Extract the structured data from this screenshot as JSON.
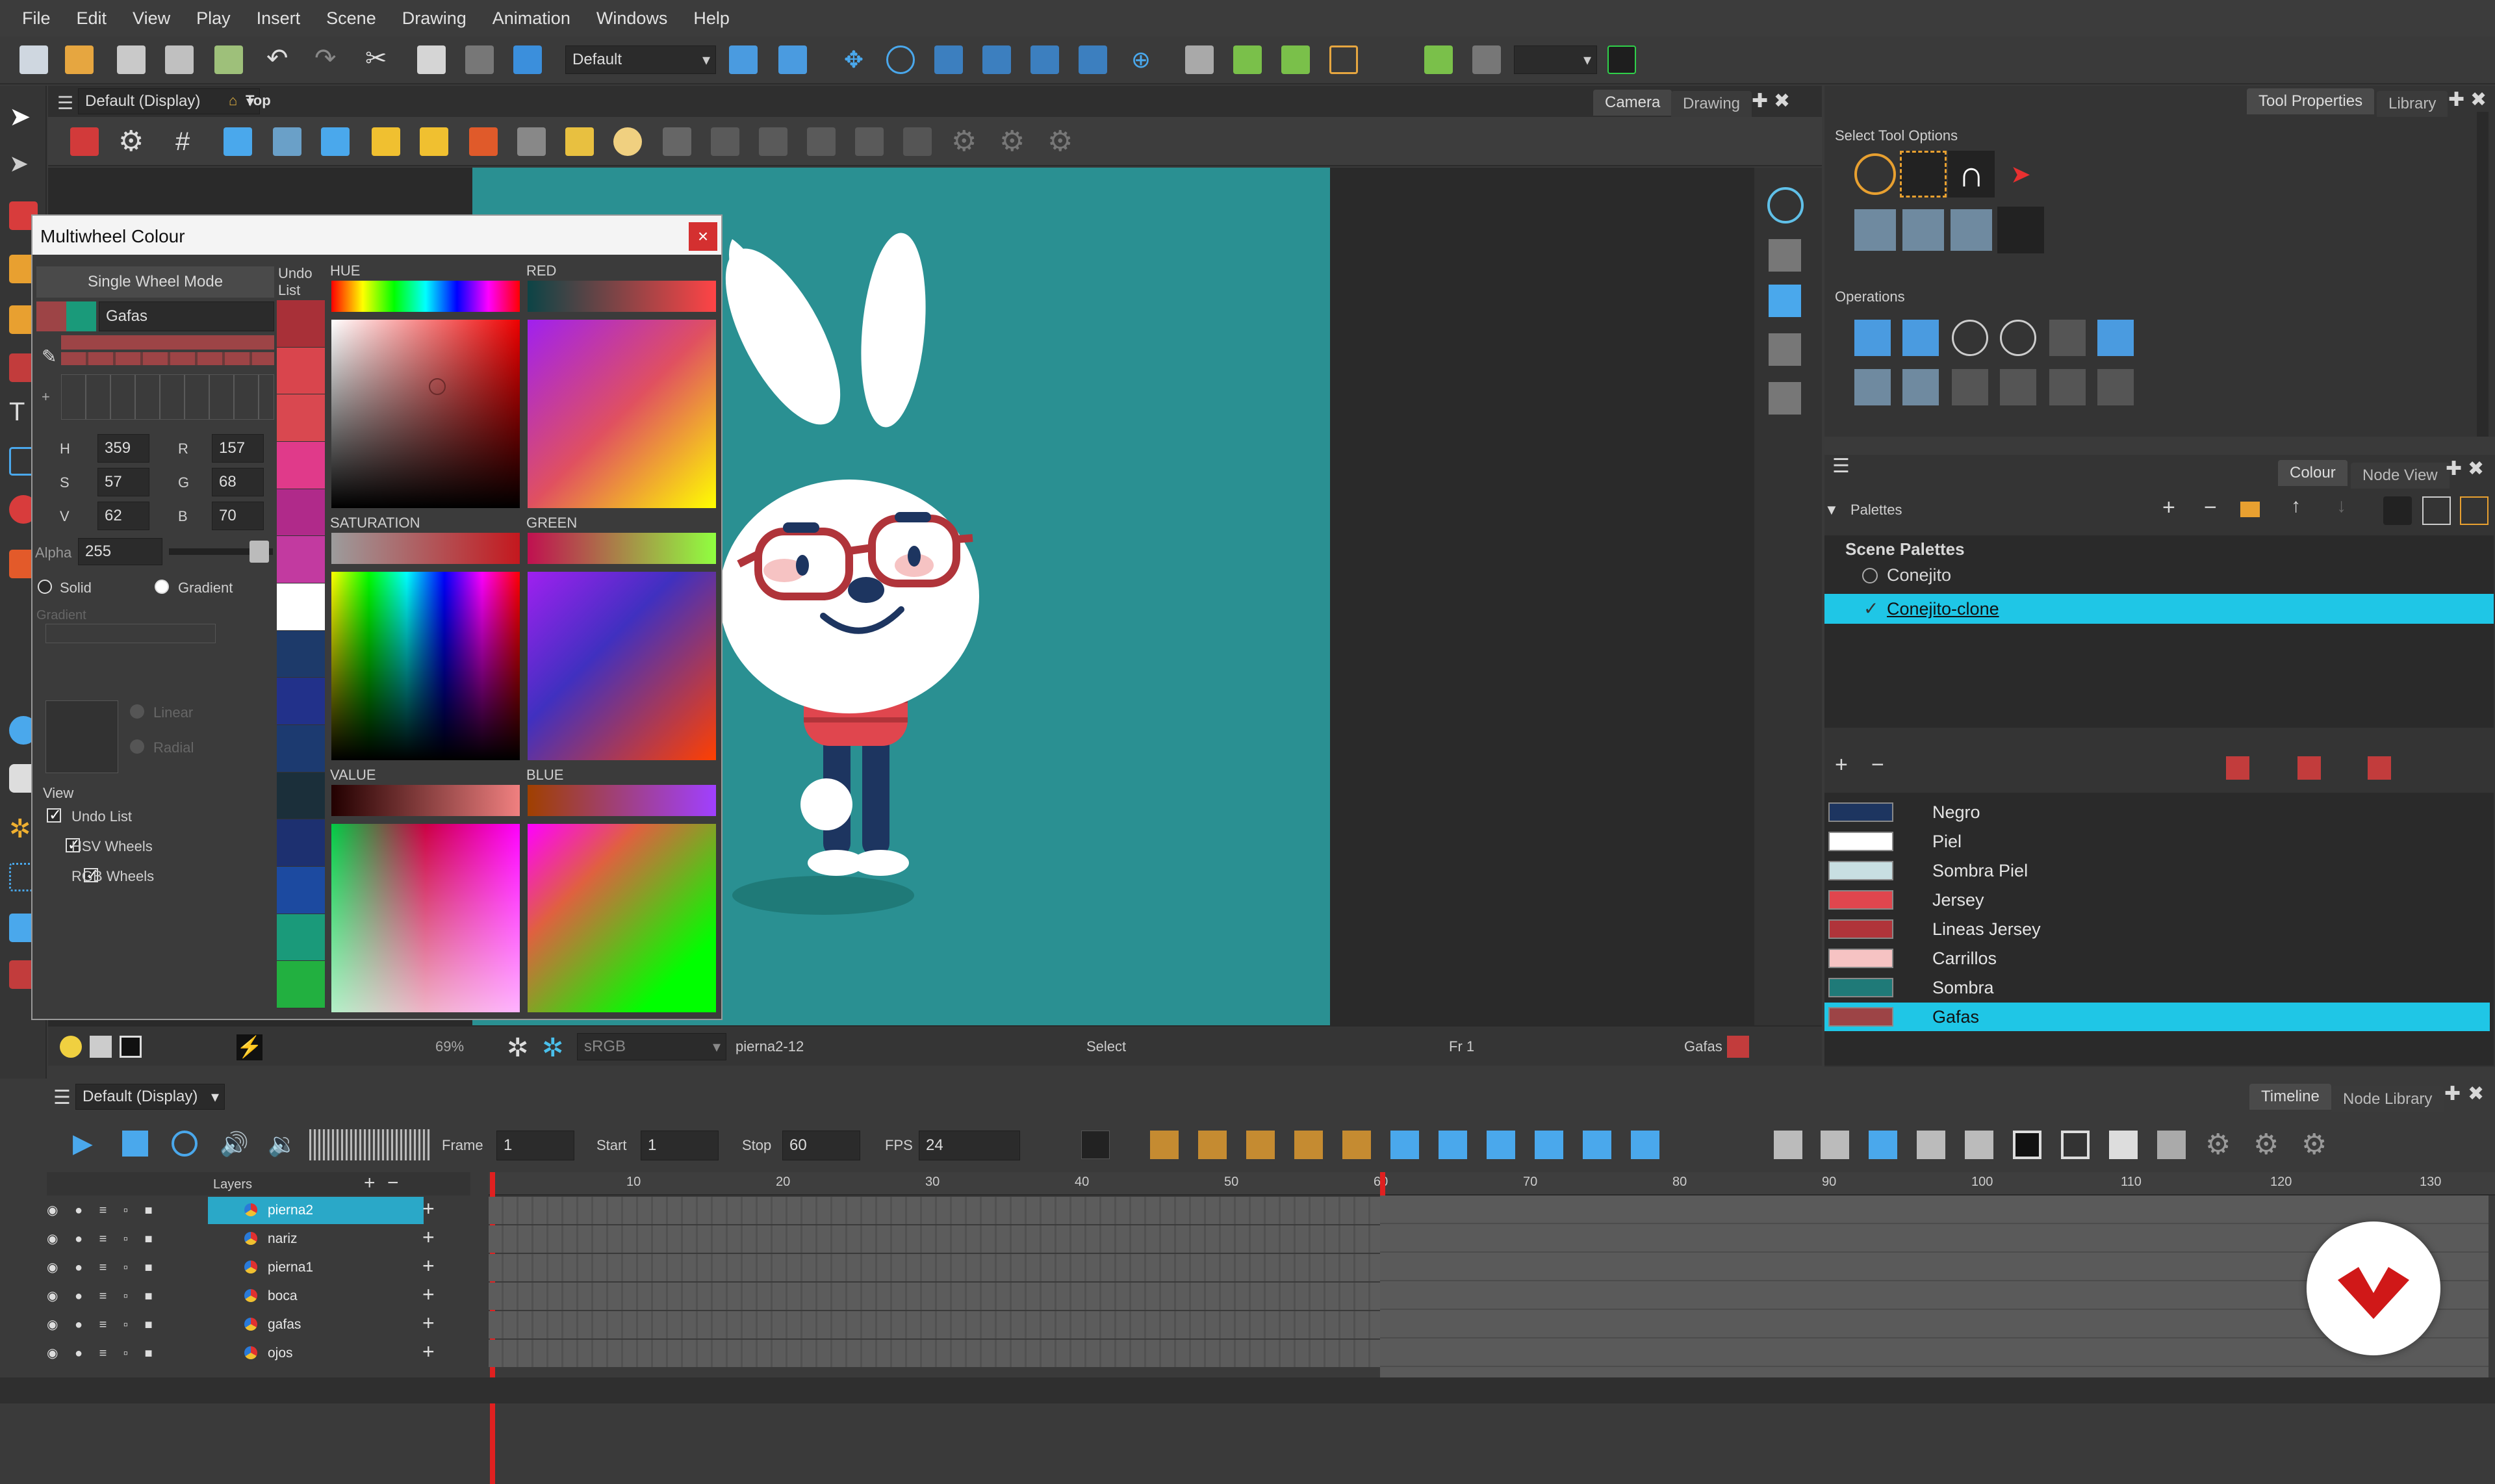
{
  "menu": [
    "File",
    "Edit",
    "View",
    "Play",
    "Insert",
    "Scene",
    "Drawing",
    "Animation",
    "Windows",
    "Help"
  ],
  "toolbar": {
    "workspace_select": "Default"
  },
  "view": {
    "header_left": "Default (Display)",
    "header_camera": "Top",
    "tab_camera": "Camera",
    "tab_drawing": "Drawing",
    "status_zoom": "69%",
    "status_colorspace": "sRGB",
    "status_drawing": "pierna2-12",
    "status_tool": "Select",
    "status_frame": "Fr 1",
    "status_colour": "Gafas"
  },
  "multiwheel": {
    "title": "Multiwheel Colour",
    "close": "×",
    "mode_button": "Single Wheel Mode",
    "colour_name": "Gafas",
    "undo_label": "Undo\nList",
    "H": "359",
    "S": "57",
    "V": "62",
    "R": "157",
    "G": "68",
    "B": "70",
    "alpha_label": "Alpha",
    "alpha": "255",
    "solid": "Solid",
    "gradient": "Gradient",
    "gradient_label": "Gradient",
    "linear": "Linear",
    "radial": "Radial",
    "view_label": "View",
    "view_undo": "Undo List",
    "view_hsv": "HSV Wheels",
    "view_rgb": "RGB Wheels",
    "hue": "HUE",
    "red": "RED",
    "saturation": "SATURATION",
    "green": "GREEN",
    "value": "VALUE",
    "blue": "BLUE",
    "labels": {
      "h": "H",
      "s": "S",
      "v": "V",
      "r": "R",
      "g": "G",
      "b": "B"
    },
    "undo_colors": [
      "#a83038",
      "#d9454d",
      "#d94850",
      "#e03a8a",
      "#b02a8a",
      "#c23aa0",
      "#ffffff",
      "#1d3a6a",
      "#22318a",
      "#1c3a70",
      "#1b2f3a",
      "#1d3070",
      "#1c4aa0",
      "#1a9a7a",
      "#22b040"
    ]
  },
  "tool_properties": {
    "tab1": "Tool Properties",
    "tab2": "Library",
    "select_options": "Select Tool Options",
    "operations": "Operations"
  },
  "colour_view": {
    "tab_colour": "Colour",
    "tab_node": "Node View",
    "palettes_label": "Palettes",
    "scene_palettes": "Scene Palettes",
    "palette1": "Conejito",
    "palette2": "Conejito-clone",
    "colours": [
      {
        "name": "Negro",
        "color": "#1d3560"
      },
      {
        "name": "Piel",
        "color": "#ffffff"
      },
      {
        "name": "Sombra Piel",
        "color": "#c8dfe2"
      },
      {
        "name": "Jersey",
        "color": "#e0464e"
      },
      {
        "name": "Lineas Jersey",
        "color": "#b0343a"
      },
      {
        "name": "Carrillos",
        "color": "#f6c3c3"
      },
      {
        "name": "Sombra",
        "color": "#1f7a78"
      },
      {
        "name": "Gafas",
        "color": "#9d4446"
      }
    ]
  },
  "timeline": {
    "header": "Default (Display)",
    "tab_timeline": "Timeline",
    "tab_node_library": "Node Library",
    "frame_label": "Frame",
    "frame": "1",
    "start_label": "Start",
    "start": "1",
    "stop_label": "Stop",
    "stop": "60",
    "fps_label": "FPS",
    "fps": "24",
    "layers_label": "Layers",
    "ruler": [
      "10",
      "20",
      "30",
      "40",
      "50",
      "60",
      "70",
      "80",
      "90",
      "100",
      "110",
      "120",
      "130"
    ],
    "layers": [
      "pierna2",
      "nariz",
      "pierna1",
      "boca",
      "gafas",
      "ojos"
    ]
  }
}
